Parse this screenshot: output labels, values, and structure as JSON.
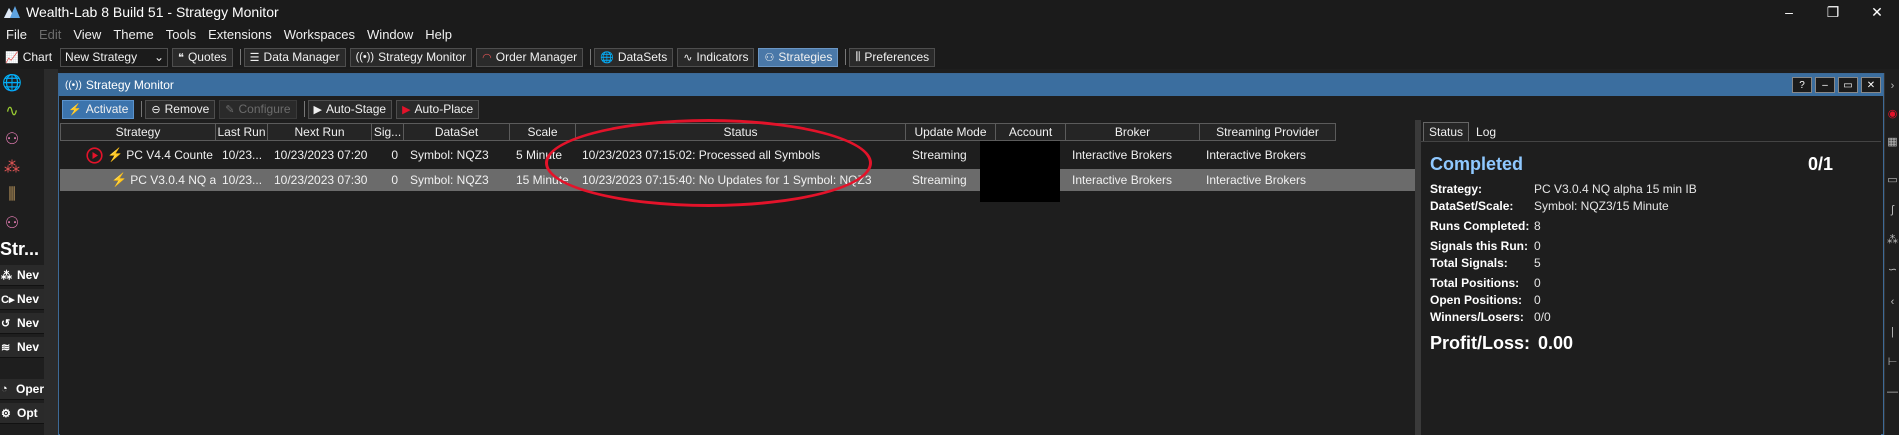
{
  "app": {
    "title": "Wealth-Lab 8 Build 51 - Strategy Monitor",
    "window_controls": [
      "–",
      "❐",
      "✕"
    ]
  },
  "menu": [
    "File",
    "Edit",
    "View",
    "Theme",
    "Tools",
    "Extensions",
    "Workspaces",
    "Window",
    "Help"
  ],
  "toolbar": {
    "chart": "Chart",
    "new_strategy": "New Strategy",
    "quotes": "Quotes",
    "data_manager": "Data Manager",
    "strategy_monitor": "Strategy Monitor",
    "order_manager": "Order Manager",
    "datasets": "DataSets",
    "indicators": "Indicators",
    "strategies": "Strategies",
    "preferences": "Preferences"
  },
  "left_rail": {
    "heading": "Str...",
    "buttons": [
      "Nev",
      "Nev",
      "Nev",
      "Nev"
    ],
    "bottom_buttons": [
      "Oper",
      "Opt"
    ]
  },
  "monitor": {
    "title": "Strategy Monitor",
    "window_controls": [
      "?",
      "–",
      "▭",
      "✕"
    ],
    "toolbar": {
      "activate": "Activate",
      "remove": "Remove",
      "configure": "Configure",
      "auto_stage": "Auto-Stage",
      "auto_place": "Auto-Place"
    },
    "columns": [
      "Strategy",
      "Last Run",
      "Next Run",
      "Sig...",
      "DataSet",
      "Scale",
      "Status",
      "Update Mode",
      "Account",
      "Broker",
      "Streaming Provider"
    ],
    "rows": [
      {
        "strategy": "PC V4.4 Counte",
        "last_run": "10/23...",
        "next_run": "10/23/2023 07:20",
        "signals": "0",
        "dataset": "Symbol: NQZ3",
        "scale": "5 Minute",
        "status": "10/23/2023 07:15:02: Processed all Symbols",
        "update_mode": "Streaming",
        "account": "",
        "broker": "Interactive Brokers",
        "streaming_provider": "Interactive Brokers"
      },
      {
        "strategy": "PC V3.0.4 NQ al",
        "last_run": "10/23...",
        "next_run": "10/23/2023 07:30",
        "signals": "0",
        "dataset": "Symbol: NQZ3",
        "scale": "15 Minute",
        "status": "10/23/2023 07:15:40: No Updates for 1 Symbol: NQZ3",
        "update_mode": "Streaming",
        "account": "",
        "broker": "Interactive Brokers",
        "streaming_provider": "Interactive Brokers"
      }
    ]
  },
  "status_panel": {
    "tabs": [
      "Status",
      "Log"
    ],
    "state": "Completed",
    "count": "0/1",
    "fields": [
      {
        "label": "Strategy:",
        "value": "PC V3.0.4 NQ alpha 15 min IB"
      },
      {
        "label": "DataSet/Scale:",
        "value": "Symbol: NQZ3/15 Minute"
      },
      {
        "label": "Runs Completed:",
        "value": "8"
      },
      {
        "label": "Signals this Run:",
        "value": "0"
      },
      {
        "label": "Total Signals:",
        "value": "5"
      },
      {
        "label": "Total Positions:",
        "value": "0"
      },
      {
        "label": "Open Positions:",
        "value": "0"
      },
      {
        "label": "Winners/Losers:",
        "value": "0/0"
      }
    ],
    "profit_loss_label": "Profit/Loss:",
    "profit_loss_value": "0.00"
  },
  "colors": {
    "accent": "#3b6e9f",
    "highlight_ellipse": "#e3132a",
    "completed": "#8fc8ff",
    "bolt": "#f1c21b"
  }
}
